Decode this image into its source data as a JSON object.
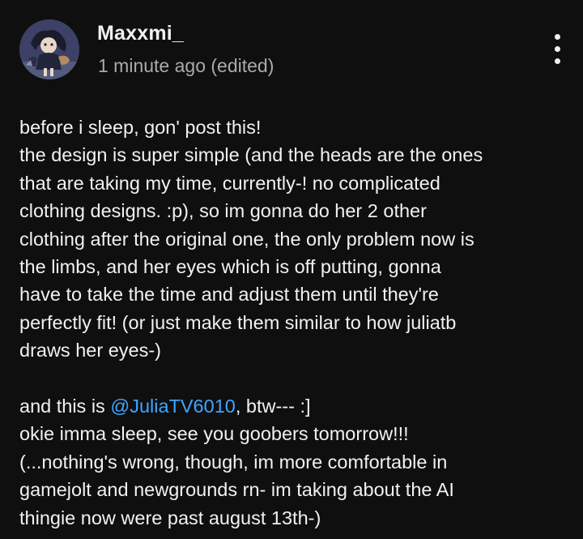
{
  "comment": {
    "author": "Maxxmi_",
    "timestamp": "1 minute ago",
    "edited_label": "(edited)",
    "avatar_icon": "user-avatar-icon",
    "more_icon": "more-vert-icon",
    "colors": {
      "background": "#0f0f0f",
      "text": "#f1f1f1",
      "meta": "#aaaaaa",
      "mention": "#3ea6ff"
    },
    "body_lines": [
      "before i sleep, gon' post this!",
      "the design is super simple (and the heads are the ones",
      "that are taking my time, currently-! no complicated",
      "clothing designs. :p), so im gonna do her 2 other",
      "clothing after the original one, the only problem now is",
      "the limbs, and her eyes which is off putting, gonna",
      "have to take the time and adjust them until they're",
      "perfectly fit! (or just make them similar to how juliatb",
      "draws her eyes-)"
    ],
    "mention_line": {
      "prefix": "and this is ",
      "mention": "@JuliaTV6010",
      "suffix": ", btw--- :]"
    },
    "body_lines_2": [
      "okie imma sleep, see you goobers tomorrow!!!",
      "(...nothing's wrong, though, im more comfortable in",
      "gamejolt and newgrounds rn- im taking about the AI",
      "thingie now were past august 13th-)"
    ]
  }
}
